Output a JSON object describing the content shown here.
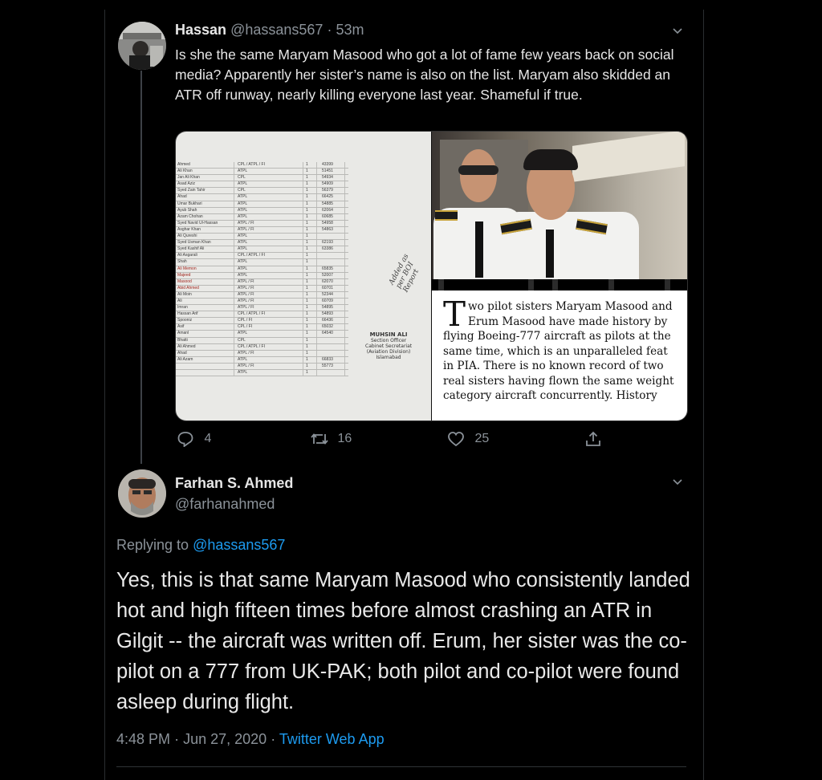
{
  "tweet1": {
    "author_name": "Hassan",
    "handle": "@hassans567",
    "separator": "·",
    "time": "53m",
    "text": "Is she the same Maryam Masood who got a lot of fame few years back on social media? Apparently her sister’s name is also on the list. Maryam also skidded an ATR off runway, nearly killing everyone last year. Shameful if true.",
    "media": {
      "document_handwriting": "Added as per BOI Report",
      "document_stamp": [
        "MUHSIN ALI",
        "Section Officer",
        "Cabinet Secretariat",
        "(Aviation Division)",
        "Islamabad"
      ],
      "document_rows": [
        [
          "Ahmed",
          "CPL / ATPL / FI",
          "1",
          "43399"
        ],
        [
          "Ali Khan",
          "ATPL",
          "1",
          "51451"
        ],
        [
          "Jan Ali Khan",
          "CPL",
          "1",
          "54934"
        ],
        [
          "Asad Aziz",
          "ATPL",
          "1",
          "54909"
        ],
        [
          "Syed Zain Tahir",
          "CPL",
          "1",
          "56379"
        ],
        [
          "Ahad",
          "ATPL",
          "1",
          "66425"
        ],
        [
          "Umar Bukhari",
          "ATPL",
          "1",
          "54885"
        ],
        [
          "Ayub Shah",
          "ATPL",
          "1",
          "62064"
        ],
        [
          "Azam Chohan",
          "ATPL",
          "1",
          "60685"
        ],
        [
          "Syed Navid Ul-Hassan",
          "ATPL / FI",
          "1",
          "54958"
        ],
        [
          "Asghar Khan",
          "ATPL / FI",
          "1",
          "54863"
        ],
        [
          "Ali Qureshi",
          "ATPL",
          "1",
          ""
        ],
        [
          "Syed Usman Khan",
          "ATPL",
          "1",
          "62193"
        ],
        [
          "Syed Kashif Ali",
          "ATPL",
          "1",
          "63386"
        ],
        [
          "Ali Asgarali",
          "CPL / ATPL / FI",
          "1",
          ""
        ],
        [
          "Shah",
          "ATPL",
          "1",
          ""
        ],
        [
          "Ali Memon",
          "ATPL",
          "1",
          "65835"
        ],
        [
          "Majeed",
          "ATPL",
          "1",
          "52007"
        ],
        [
          "Masood",
          "ATPL / FI",
          "1",
          "62070"
        ],
        [
          "Abid Ahmed",
          "ATPL / FI",
          "1",
          "60701"
        ],
        [
          "Ali Moin",
          "ATPL / FI",
          "1",
          "52344"
        ],
        [
          "Ali",
          "ATPL / FI",
          "1",
          "60709"
        ],
        [
          "Imran",
          "ATPL / FI",
          "1",
          "54895"
        ],
        [
          "Hassan Arif",
          "CPL / ATPL / FI",
          "1",
          "54893"
        ],
        [
          "Spooniz",
          "CPL / FI",
          "1",
          "66436"
        ],
        [
          "Asif",
          "CPL / FI",
          "1",
          "65032"
        ],
        [
          "Amanl",
          "ATPL",
          "1",
          "64540"
        ],
        [
          "Bhatti",
          "CPL",
          "1",
          ""
        ],
        [
          "Ali Ahmed",
          "CPL / ATPL / FI",
          "1",
          ""
        ],
        [
          "Ahad",
          "ATPL / FI",
          "1",
          ""
        ],
        [
          "Ali Azam",
          "ATPL",
          "1",
          "66833"
        ],
        [
          "",
          "ATPL / FI",
          "1",
          "55773"
        ],
        [
          "",
          "ATPL",
          "1",
          ""
        ]
      ],
      "article_dropcap": "T",
      "article_text": "wo pilot sisters Maryam Masood and Erum Masood have made history by flying Boeing-777 aircraft as pilots at the same time, which is an unparalleled feat in PIA. There is no known record of two real sisters having flown the same weight category aircraft concurrently. History"
    },
    "actions": {
      "replies": "4",
      "retweets": "16",
      "likes": "25"
    }
  },
  "tweet2": {
    "author_name": "Farhan S. Ahmed",
    "handle": "@farhanahmed",
    "replying_prefix": "Replying to ",
    "replying_handle": "@hassans567",
    "text": "Yes, this is that same Maryam Masood who consistently landed hot and high fifteen times before almost crashing an ATR in Gilgit -- the aircraft was written off. Erum, her sister was the co-pilot on a 777 from UK-PAK; both pilot and co-pilot were found asleep during flight.",
    "time": "4:48 PM",
    "separator": "·",
    "date": "Jun 27, 2020",
    "source": "Twitter Web App"
  },
  "icons": {
    "reply": "reply-icon",
    "retweet": "retweet-icon",
    "like": "heart-icon",
    "share": "share-icon",
    "more": "chevron-down-icon"
  },
  "colors": {
    "background": "#000000",
    "text": "#e6e6e6",
    "muted": "#8b9299",
    "link": "#1d9bf0"
  }
}
